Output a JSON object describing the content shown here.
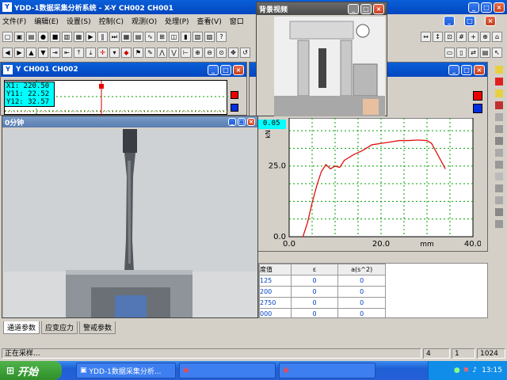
{
  "app": {
    "title": "YDD-1数据采集分析系统 - X-Y CH002 CH001"
  },
  "menu": [
    "文件(F)",
    "编辑(E)",
    "设置(S)",
    "控制(C)",
    "观测(O)",
    "处理(P)",
    "查看(V)",
    "窗口"
  ],
  "ch_window": {
    "title": "Y CH001 CH002",
    "readout": [
      "X1: 220.50",
      "Y11: 22.52",
      "Y12: 32.57"
    ]
  },
  "video_window": {
    "title": "0分钟"
  },
  "bg_video": {
    "title": "背景视频"
  },
  "xy_plot": {
    "readout": ": 0.05",
    "ylabel": "kN",
    "xlabel": "mm",
    "ytick_labels": [
      "0.0",
      "25.0"
    ],
    "xtick_labels": [
      "0.0",
      "20.0",
      "40.0"
    ]
  },
  "chart_data": {
    "type": "line",
    "title": "",
    "xlabel": "mm",
    "ylabel": "kN",
    "xlim": [
      0.0,
      40.0
    ],
    "ylim": [
      0.0,
      42.0
    ],
    "grid": true,
    "series": [
      {
        "color": "#e01010",
        "x": [
          3.0,
          4.0,
          5.0,
          6.0,
          7.0,
          8.0,
          9.0,
          10.0,
          11.0,
          12.0,
          14.0,
          16.0,
          18.0,
          20.0,
          22.0,
          24.0,
          26.0,
          28.0,
          30.0,
          31.0,
          32.0,
          33.0,
          34.0
        ],
        "y": [
          0.0,
          5.0,
          12.0,
          18.0,
          23.0,
          25.5,
          24.0,
          25.0,
          24.5,
          27.0,
          29.0,
          30.5,
          32.5,
          33.0,
          33.5,
          34.0,
          34.0,
          34.2,
          34.0,
          33.0,
          30.0,
          27.0,
          24.0
        ]
      }
    ]
  },
  "table": {
    "headers": [
      "度值",
      "ε",
      "a(s^2)"
    ],
    "rows": [
      [
        "125",
        "0",
        "0"
      ],
      [
        "200",
        "0",
        "0"
      ],
      [
        "2750",
        "0",
        "0"
      ],
      [
        "000",
        "0",
        "0"
      ]
    ]
  },
  "tabs": [
    "通道参数",
    "应变应力",
    "警戒参数"
  ],
  "status": {
    "text": "正在采样...",
    "cells": [
      "4",
      "1",
      "1024"
    ]
  },
  "taskbar": {
    "start": "开始",
    "item1": "YDD-1数据采集分析...",
    "time": "13:15"
  },
  "colors": {
    "accent": "#0a5fd8",
    "curve": "#e01010",
    "grid": "#00a000",
    "readout_bg": "#00ffff"
  }
}
